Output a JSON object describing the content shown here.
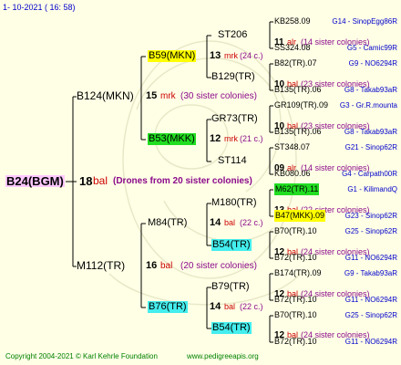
{
  "date_line": "1-  10-2021  (  16:  58)",
  "footer_left": "Copyright 2004-2021 © Karl Kehrle Foundation",
  "footer_right": "www.pedigreeapis.org",
  "colors": {
    "bg": "#ffffe6",
    "line": "#000000",
    "blue": "#0000cc",
    "red": "#cc0000",
    "purple": "#8b0a8b",
    "green": "#008000",
    "root_hl": "#ffc8ff",
    "yellow_hl": "#ffff00",
    "green_hl": "#22dd22",
    "cyan_hl": "#44eeee"
  },
  "root": {
    "label": "B24(BGM)",
    "num": "18",
    "code": "bal",
    "note": "(Drones from 20 sister colonies)"
  },
  "gen1": [
    {
      "name": "B124(MKN)",
      "num": "15",
      "code": "mrk",
      "note": "(30 sister colonies)"
    },
    {
      "name": "M112(TR)",
      "num": "16",
      "code": "bal",
      "note": "(20 sister colonies)"
    }
  ],
  "gen2": [
    {
      "name": "B59(MKN)",
      "num": "13",
      "code": "mrk",
      "note": "(24 c.)"
    },
    {
      "name": "B53(MKK)",
      "num": "12",
      "code": "mrk",
      "note": "(21 c.)"
    },
    {
      "name": "M84(TR)",
      "num": "14",
      "code": "bal",
      "note": "(22 c.)"
    },
    {
      "name": "B76(TR)",
      "num": "14",
      "code": "bal",
      "note": "(22 c.)"
    }
  ],
  "gen3": [
    {
      "name": "ST206",
      "num": "11",
      "code": "alr",
      "note": "(14 sister colonies)"
    },
    {
      "name": "B129(TR)",
      "num": "10",
      "code": "bal",
      "note": "(23 sister colonies)"
    },
    {
      "name": "GR73(TR)",
      "num": "10",
      "code": "bal",
      "note": "(23 sister colonies)"
    },
    {
      "name": "ST114",
      "num": "09",
      "code": "alr",
      "note": "(14 sister colonies)"
    },
    {
      "name": "M180(TR)",
      "num": "13",
      "code": "bal",
      "note": "(22 sister colonies)"
    },
    {
      "name": "B54(TR)",
      "num": "12",
      "code": "bal",
      "note": "(24 sister colonies)"
    },
    {
      "name": "B79(TR)",
      "num": "12",
      "code": "bal",
      "note": "(24 sister colonies)"
    },
    {
      "name": "B54(TR)",
      "num": "12",
      "code": "bal",
      "note": "(24 sister colonies)"
    }
  ],
  "gen4": [
    {
      "name": "KB258.09",
      "ref": "G14 - SinopEgg86R"
    },
    {
      "name": "SS324.08",
      "ref": "G5 - Camic99R"
    },
    {
      "name": "B82(TR).07",
      "ref": "G9 - NO6294R"
    },
    {
      "name": "B135(TR).06",
      "ref": "G8 - Takab93aR"
    },
    {
      "name": "GR109(TR).09",
      "ref": "G3 - Gr.R.mounta"
    },
    {
      "name": "B135(TR).06",
      "ref": "G8 - Takab93aR"
    },
    {
      "name": "ST348.07",
      "ref": "G21 - Sinop62R"
    },
    {
      "name": "KB080.06",
      "ref": "G4 - Carpath00R"
    },
    {
      "name": "M62(TR).11",
      "ref": "G1 - KilimandQ"
    },
    {
      "name": "B47(MKK).09",
      "ref": "G23 - Sinop62R"
    },
    {
      "name": "B70(TR).10",
      "ref": "G25 - Sinop62R"
    },
    {
      "name": "B72(TR).10",
      "ref": "G11 - NO6294R"
    },
    {
      "name": "B174(TR).09",
      "ref": "G9 - Takab93aR"
    },
    {
      "name": "B72(TR).10",
      "ref": "G11 - NO6294R"
    },
    {
      "name": "B70(TR).10",
      "ref": "G25 - Sinop62R"
    },
    {
      "name": "B72(TR).10",
      "ref": "G11 - NO6294R"
    }
  ]
}
